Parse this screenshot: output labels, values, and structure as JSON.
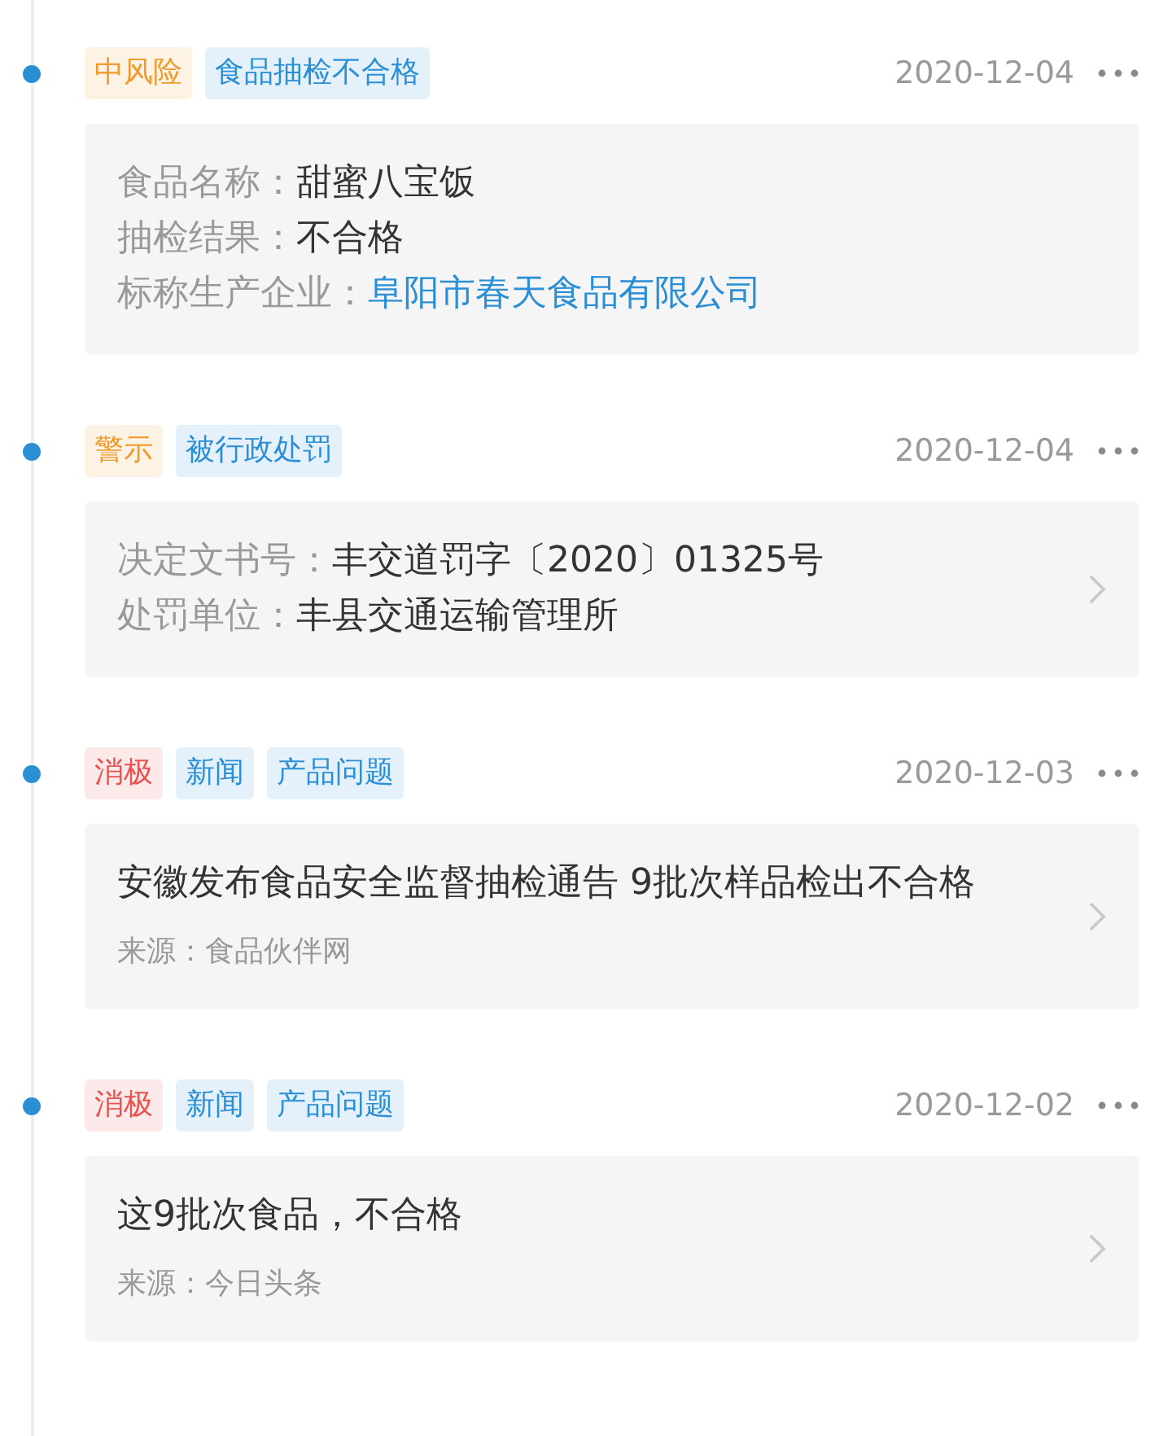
{
  "events": [
    {
      "tags": [
        {
          "label": "中风险",
          "color": "#f09a2c"
        },
        {
          "label": "食品抽检不合格",
          "color": "#2b8fd6"
        }
      ],
      "date": "2020-12-04",
      "kind": "fields",
      "has_arrow": false,
      "fields": [
        {
          "label": "食品名称：",
          "value": "甜蜜八宝饭",
          "link": false
        },
        {
          "label": "抽检结果：",
          "value": "不合格",
          "link": false
        },
        {
          "label": "标称生产企业：",
          "value": "阜阳市春天食品有限公司",
          "link": true
        }
      ]
    },
    {
      "tags": [
        {
          "label": "警示",
          "color": "#f09a2c"
        },
        {
          "label": "被行政处罚",
          "color": "#2b8fd6"
        }
      ],
      "date": "2020-12-04",
      "kind": "fields",
      "has_arrow": true,
      "fields": [
        {
          "label": "决定文书号：",
          "value": "丰交道罚字〔2020〕01325号",
          "link": false
        },
        {
          "label": "处罚单位：",
          "value": "丰县交通运输管理所",
          "link": false
        }
      ]
    },
    {
      "tags": [
        {
          "label": "消极",
          "color": "#e8534f"
        },
        {
          "label": "新闻",
          "color": "#2b8fd6"
        },
        {
          "label": "产品问题",
          "color": "#2b8fd6"
        }
      ],
      "date": "2020-12-03",
      "kind": "news",
      "has_arrow": true,
      "title": "安徽发布食品安全监督抽检通告 9批次样品检出不合格",
      "source_label": "来源：",
      "source": "食品伙伴网"
    },
    {
      "tags": [
        {
          "label": "消极",
          "color": "#e8534f"
        },
        {
          "label": "新闻",
          "color": "#2b8fd6"
        },
        {
          "label": "产品问题",
          "color": "#2b8fd6"
        }
      ],
      "date": "2020-12-02",
      "kind": "news",
      "has_arrow": true,
      "title": "这9批次食品，不合格",
      "source_label": "来源：",
      "source": "今日头条"
    }
  ]
}
